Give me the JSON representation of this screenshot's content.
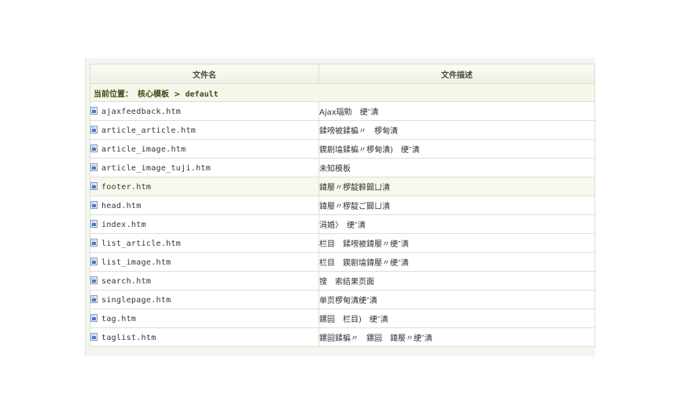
{
  "table": {
    "headers": {
      "name": "文件名",
      "description": "文件描述"
    },
    "location": {
      "label": "当前位置：",
      "folder": "核心模板",
      "separator": ">",
      "current": "default"
    },
    "rows": [
      {
        "name": "ajaxfeedback.htm",
        "description": "Ajax瑙勯　绠″潰"
      },
      {
        "name": "article_article.htm",
        "description": "鍒嗙被鍒楄〃　椤甸潰"
      },
      {
        "name": "article_image.htm",
        "description": "鍥剧墖鍒楄〃椤甸潰)　绠″潰"
      },
      {
        "name": "article_image_tuji.htm",
        "description": "未知模板"
      },
      {
        "name": "footer.htm",
        "description": "鍏嬮〃椤靛簳閮ㄩ潰",
        "highlight": true
      },
      {
        "name": "head.htm",
        "description": "鍏嬮〃椤靛ご閮ㄩ潰"
      },
      {
        "name": "index.htm",
        "description": "涓婚〉　绠″潰"
      },
      {
        "name": "list_article.htm",
        "description": "栏目　鍒嗙被鍏嬮〃绠″潰"
      },
      {
        "name": "list_image.htm",
        "description": "栏目　鍥剧墖鍏嬮〃绠″潰"
      },
      {
        "name": "search.htm",
        "description": "搜　索结果页面"
      },
      {
        "name": "singlepage.htm",
        "description": "单页椤甸潰绠″潰"
      },
      {
        "name": "tag.htm",
        "description": "鏍囩　栏目)　绠″潰"
      },
      {
        "name": "taglist.htm",
        "description": "鏍囩鍒楄〃　鏍囩　鍏嬮〃绠″潰"
      }
    ]
  },
  "icons": {
    "file": "html-file-icon"
  },
  "colors": {
    "header_bg": "#eef0e6",
    "location_bg": "#f6f7e8",
    "highlight_bg": "#f7f8ec",
    "border": "#dcdfd6",
    "icon_blue": "#4a79c0"
  }
}
